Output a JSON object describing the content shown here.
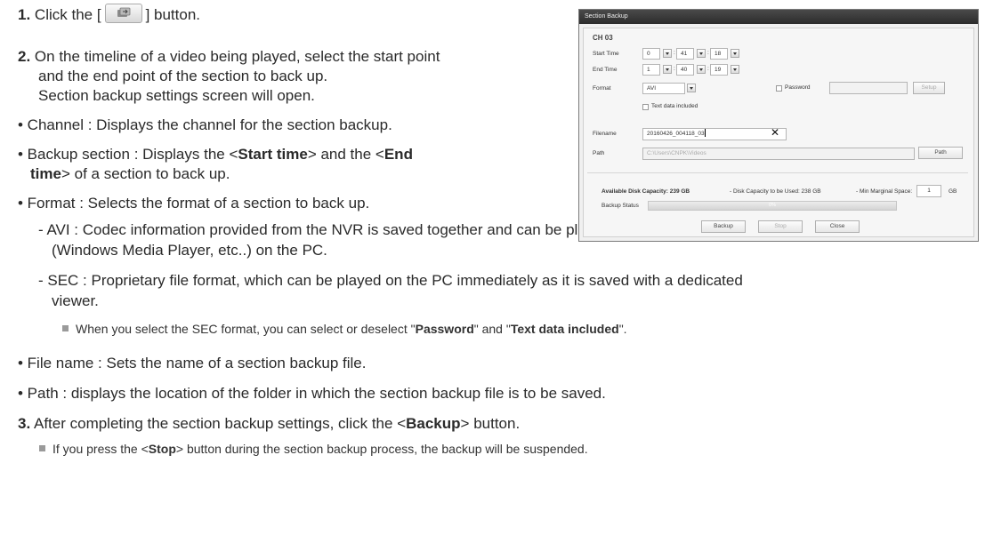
{
  "doc": {
    "step1": {
      "num": "1.",
      "pre": "Click the [",
      "post": "] button."
    },
    "step2": {
      "num": "2.",
      "line1": "On the timeline of a video being played, select the start point",
      "line2": "and the end point of the section to back up.",
      "line3": "Section backup settings screen will open."
    },
    "b_channel": "• Channel : Displays the channel for the section backup.",
    "b_section": {
      "a": "• Backup section : Displays the <",
      "b": "Start time",
      "c": "> and the <",
      "d": "End",
      "e": "time",
      "f": "> of a section to back up."
    },
    "b_format": "• Format : Selects the format of a section to back up.",
    "avi1": "- AVI : Codec information provided from the NVR is saved together and can be played on a separate viewer",
    "avi2": "(Windows Media Player, etc..) on the PC.",
    "sec1": "- SEC : Proprietary file format, which can be played on the PC immediately as it is saved with a dedicated",
    "sec2": "viewer.",
    "note1": {
      "a": "When you select the SEC format, you can select or deselect \"",
      "b": "Password",
      "c": "\" and \"",
      "d": "Text data included",
      "e": "\"."
    },
    "b_filename": "• File name : Sets the name of a section backup file.",
    "b_path": "• Path : displays the location of the folder in which the section backup file is to be saved.",
    "step3": {
      "num": "3.",
      "a": "After completing the section backup settings, click the <",
      "b": "Backup",
      "c": "> button."
    },
    "note2": {
      "a": "If you press the <",
      "b": "Stop",
      "c": "> button during the section backup process, the backup will be suspended."
    }
  },
  "dialog": {
    "title": "Section Backup",
    "channel": "CH 03",
    "start_label": "Start Time",
    "start": [
      "0",
      "41",
      "18"
    ],
    "end_label": "End Time",
    "end": [
      "1",
      "40",
      "19"
    ],
    "format_label": "Format",
    "format_value": "AVI",
    "password_label": "Password",
    "setup_button": "Setup",
    "text_data_label": "Text data included",
    "filename_label": "Filename",
    "filename_value": "20160426_004118_03",
    "path_label": "Path",
    "path_value": "C:\\Users\\CNPK\\Videos",
    "path_button": "Path",
    "avail_label": "Available Disk Capacity: 239 GB",
    "used_label": "- Disk Capacity to be Used: 238 GB",
    "margin_label": "- Min Marginal Space:",
    "margin_value": "1",
    "margin_unit": "GB",
    "status_label": "Backup Status",
    "progress_text": "0%",
    "progress": 0,
    "backup_button": "Backup",
    "stop_button": "Stop",
    "close_button": "Close"
  }
}
